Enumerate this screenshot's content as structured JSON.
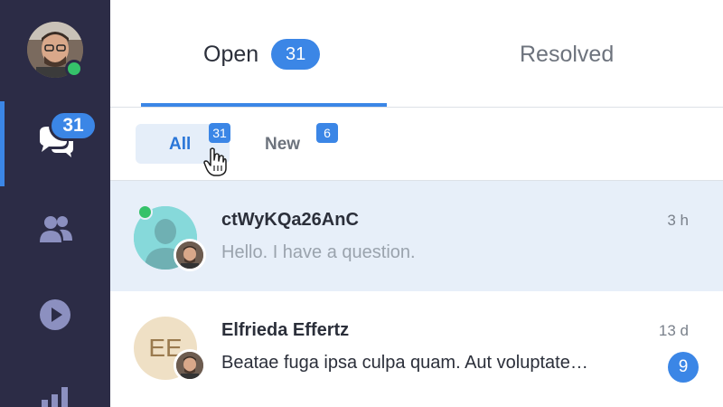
{
  "sidebar": {
    "conversations_badge": "31",
    "icons": [
      "chat-bubbles-icon",
      "people-icon",
      "play-icon",
      "stats-icon"
    ]
  },
  "tabs": [
    {
      "label": "Open",
      "badge": "31",
      "active": true
    },
    {
      "label": "Resolved",
      "active": false
    }
  ],
  "filters": {
    "all": {
      "label": "All",
      "count": "31"
    },
    "new": {
      "label": "New",
      "count": "6"
    }
  },
  "conversations": [
    {
      "name": "ctWyKQa26AnC",
      "message": "Hello. I have a question.",
      "time": "3 h",
      "online": true
    },
    {
      "name": "Elfrieda Effertz",
      "initials": "EE",
      "message": "Beatae fuga ipsa culpa quam. Aut voluptate…",
      "time": "13 d",
      "unread": "9"
    }
  ],
  "colors": {
    "accent": "#3b86e6",
    "sidebar": "#2c2c46",
    "online": "#35c26a",
    "selected_row": "#e7eff9"
  }
}
